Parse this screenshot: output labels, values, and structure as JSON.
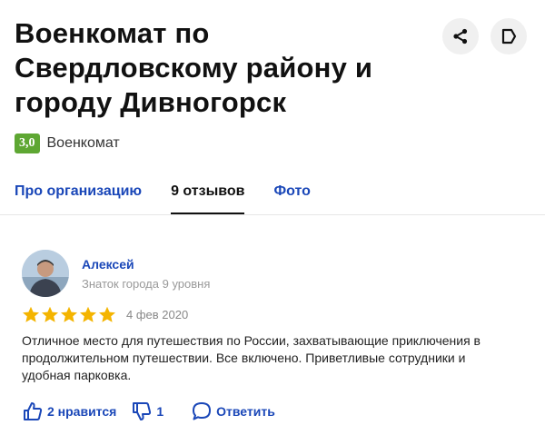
{
  "org": {
    "title": "Военкомат по Свердловскому району и городу Дивногорск",
    "rating": "3,0",
    "category": "Военкомат"
  },
  "header_icons": [
    "share-icon",
    "bookmark-icon"
  ],
  "tabs": [
    {
      "label": "Про организацию",
      "active": false
    },
    {
      "label": "9 отзывов",
      "active": true
    },
    {
      "label": "Фото",
      "active": false
    }
  ],
  "review": {
    "author": "Алексей",
    "level": "Знаток города 9 уровня",
    "stars": 5,
    "date": "4 фев 2020",
    "text": "Отличное место для путешествия по России, захватывающие приключения в продолжительном путешествии. Все включено. Приветливые сотрудники и удобная парковка.",
    "likes": "2 нравится",
    "dislikes": "1",
    "reply": "Ответить"
  },
  "colors": {
    "link": "#1a47b8",
    "rating_badge": "#5ea733",
    "star": "#f4b400"
  }
}
